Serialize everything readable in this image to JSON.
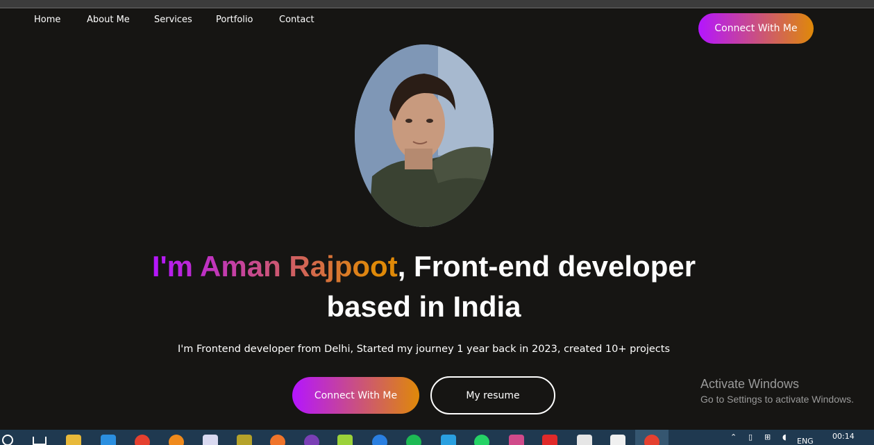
{
  "nav": {
    "links": [
      "Home",
      "About Me",
      "Services",
      "Portfolio",
      "Contact"
    ],
    "connect_label": "Connect With Me"
  },
  "hero": {
    "name_part": "I'm Aman Rajpoot",
    "title_rest": ", Front-end developer",
    "title_line2": "based in India",
    "subtitle": "I'm Frontend developer from Delhi, Started my journey 1 year back in 2023, created 10+ projects",
    "connect_label": "Connect With Me",
    "resume_label": "My resume"
  },
  "colors": {
    "background": "#161513",
    "gradient_start": "#b415ff",
    "gradient_end": "#df8908",
    "taskbar": "#1f3950"
  },
  "watermark": {
    "title": "Activate Windows",
    "subtitle": "Go to Settings to activate Windows."
  },
  "taskbar": {
    "icons": [
      "search-icon",
      "task-view-icon",
      "file-explorer-icon",
      "vscode-icon",
      "chrome-icon",
      "firefox-icon",
      "dev-icon",
      "medium-icon",
      "dex-icon",
      "github-icon",
      "pycharm-icon",
      "zoom-icon",
      "spotify-icon",
      "telegram-icon",
      "whatsapp-icon",
      "snipping-tool-icon",
      "youtube-icon",
      "terminal-icon",
      "camera-icon",
      "chrome-active-icon"
    ],
    "language": "ENG",
    "time": "00:14"
  }
}
